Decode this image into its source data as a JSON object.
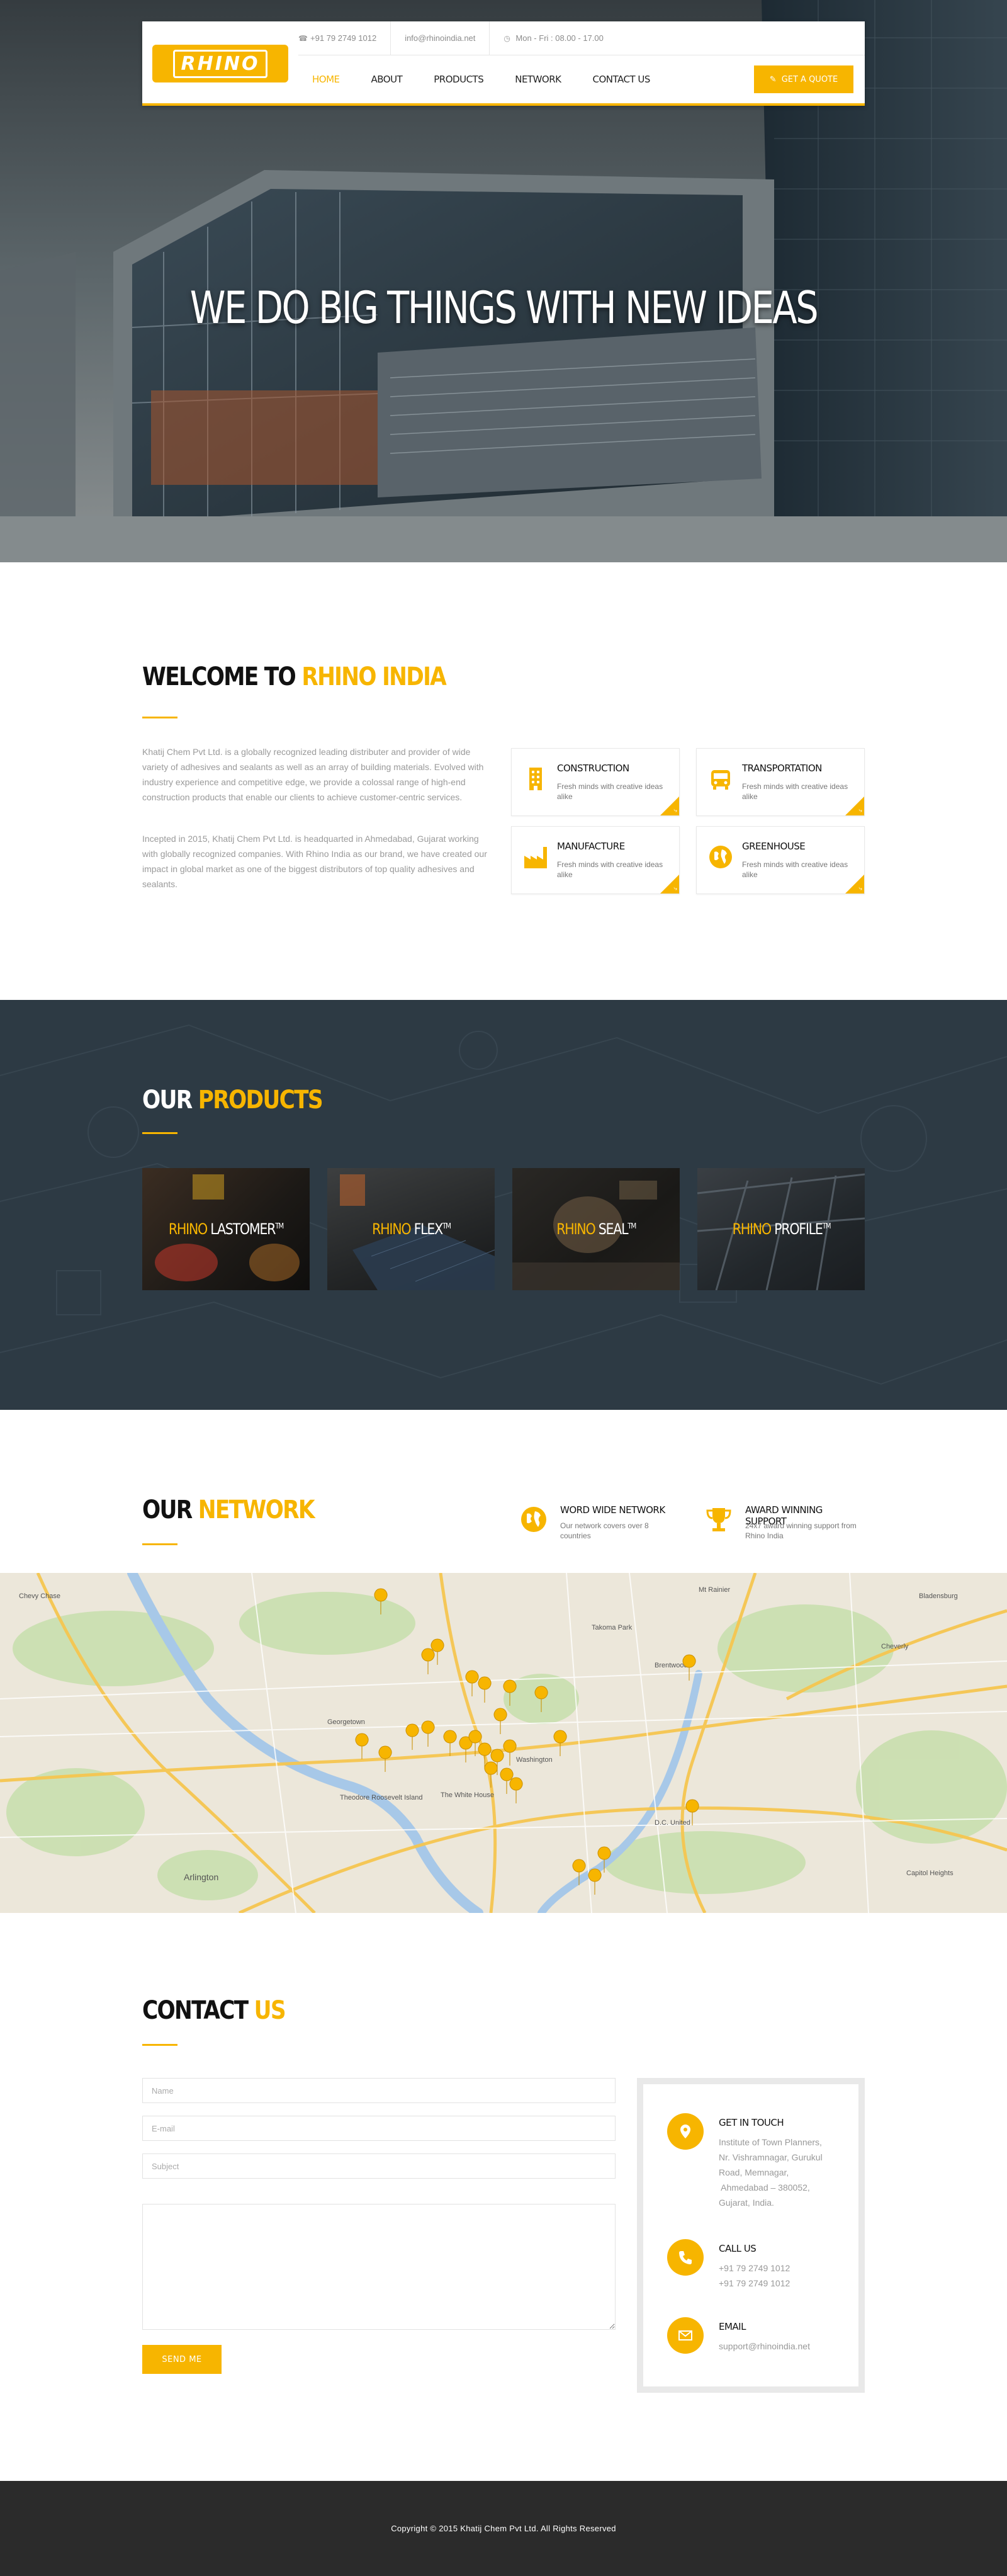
{
  "colors": {
    "accent": "#f7b500",
    "dark_section": "#2d3a44",
    "footer": "#2b2b2b",
    "text_muted": "#9a9a9a"
  },
  "header": {
    "logo_text": "RHINO",
    "topbar": {
      "phone": "+91 79 2749 1012",
      "email": "info@rhinoindia.net",
      "hours": "Mon - Fri : 08.00 - 17.00"
    },
    "nav": [
      {
        "label": "Home",
        "active": true
      },
      {
        "label": "About",
        "active": false
      },
      {
        "label": "Products",
        "active": false
      },
      {
        "label": "Network",
        "active": false
      },
      {
        "label": "Contact Us",
        "active": false
      }
    ],
    "quote_button": "Get a Quote"
  },
  "hero": {
    "title": "WE DO BIG THINGS WITH NEW IDEAS"
  },
  "welcome": {
    "title_plain": "WELCOME TO ",
    "title_accent": "RHINO INDIA",
    "paragraphs": [
      "Khatij Chem Pvt Ltd. is a globally recognized leading distributer and provider of wide variety of adhesives and sealants as well as an array of building materials. Evolved with industry experience and competitive edge, we provide a colossal range of high-end construction products that enable our clients to achieve customer-centric services.",
      "Incepted in 2015, Khatij Chem Pvt Ltd. is headquarted in Ahmedabad, Gujarat working with globally recognized companies. With Rhino India as our brand, we have created our impact in global market as one of the biggest distributors of top quality adhesives and sealants."
    ],
    "cards": [
      {
        "title": "Construction",
        "text": "Fresh minds with creative ideas alike",
        "icon": "building-icon"
      },
      {
        "title": "Transportation",
        "text": "Fresh minds with creative ideas alike",
        "icon": "bus-icon"
      },
      {
        "title": "Manufacture",
        "text": "Fresh minds with creative ideas alike",
        "icon": "factory-icon"
      },
      {
        "title": "Greenhouse",
        "text": "Fresh minds with creative ideas alike",
        "icon": "globe-icon"
      }
    ]
  },
  "products": {
    "title_plain": "OUR ",
    "title_accent": "PRODUCTS",
    "items": [
      {
        "brand": "RHINO",
        "name": " LASTOMER",
        "tm": "TM"
      },
      {
        "brand": "RHINO",
        "name": " FLEX",
        "tm": "TM"
      },
      {
        "brand": "RHINO",
        "name": " SEAL",
        "tm": "TM"
      },
      {
        "brand": "RHINO",
        "name": " PROFILE",
        "tm": "TM"
      }
    ]
  },
  "network": {
    "title_plain": "OUR ",
    "title_accent": "NETWORK",
    "features": [
      {
        "title": "Word Wide Network",
        "text": "Our network covers over 8 countries",
        "icon": "globe-icon"
      },
      {
        "title": "Award Winning Support",
        "text": "24x7 award winning support from Rhino India",
        "icon": "trophy-icon"
      }
    ],
    "map_labels": [
      "Arlington",
      "Washington",
      "Theodore Roosevelt Island",
      "The White House",
      "Takoma Park",
      "Brentwood",
      "Cheverly",
      "Capitol Heights",
      "Bladensburg",
      "Mt Rainier",
      "Chevy Chase",
      "Georgetown",
      "D.C. United"
    ]
  },
  "contact": {
    "title_plain": "CONTACT ",
    "title_accent": "US",
    "placeholders": {
      "name": "Name",
      "email": "E-mail",
      "subject": "Subject",
      "message": ""
    },
    "send_button": "Send Me",
    "info": {
      "get_in_touch_title": "Get in Touch",
      "address": [
        "Institute of Town Planners,",
        "Nr. Vishramnagar, Gurukul",
        "Road, Memnagar,",
        " Ahmedabad – 380052,",
        "Gujarat, India."
      ],
      "call_title": "Call Us",
      "phones": [
        "+91 79 2749 1012",
        "+91 79 2749 1012"
      ],
      "email_title": "Email",
      "email": "support@rhinoindia.net"
    }
  },
  "footer": {
    "copyright": "Copyright © 2015 Khatij Chem Pvt Ltd. All Rights Reserved"
  }
}
